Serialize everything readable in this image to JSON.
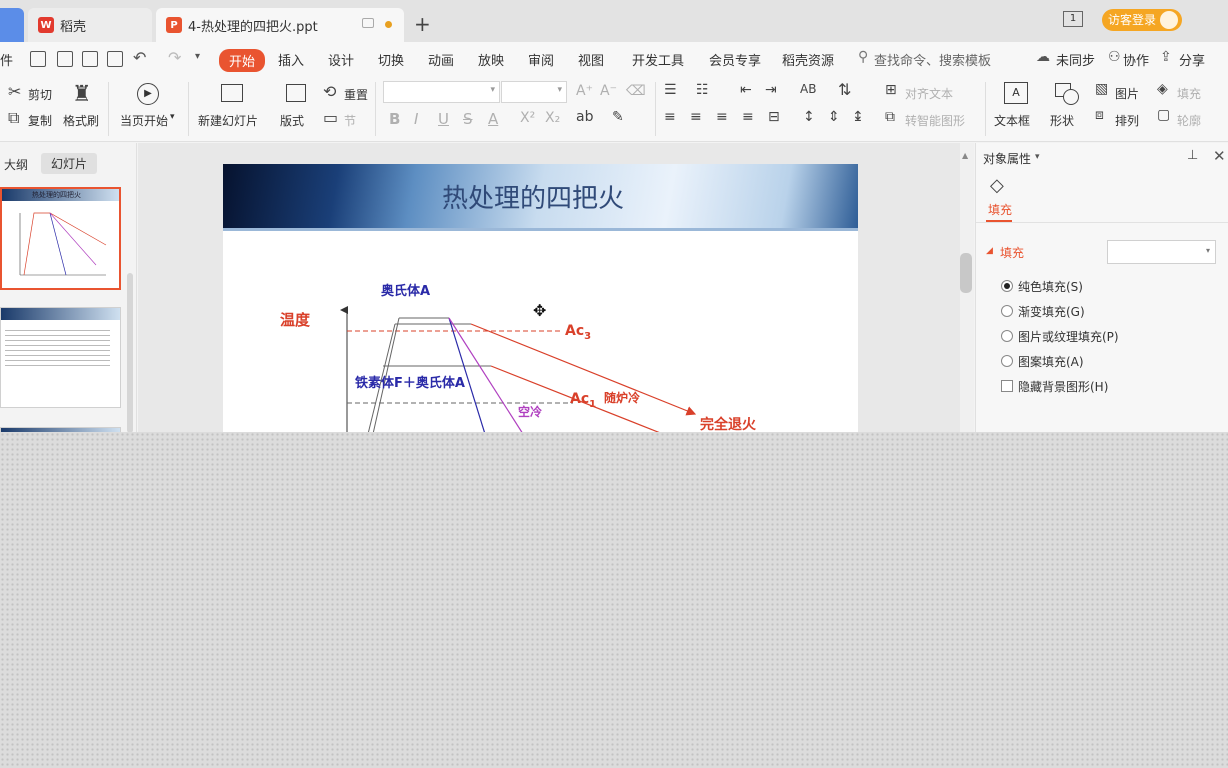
{
  "tabs": [
    {
      "label": "稻壳"
    },
    {
      "label": "4-热处理的四把火.ppt"
    }
  ],
  "titlebar": {
    "new_tab": "+",
    "window_count": "1",
    "login": "访客登录"
  },
  "menu": {
    "file_partial": "件",
    "items": [
      "开始",
      "插入",
      "设计",
      "切换",
      "动画",
      "放映",
      "审阅",
      "视图",
      "开发工具",
      "会员专享",
      "稻壳资源"
    ],
    "active_index": 0,
    "search_placeholder": "查找命令、搜索模板",
    "sync": "未同步",
    "collab": "协作",
    "share": "分享"
  },
  "ribbon": {
    "cut": "剪切",
    "copy": "复制",
    "format_painter": "格式刷",
    "play_from_current": "当页开始",
    "new_slide": "新建幻灯片",
    "layout": "版式",
    "reset": "重置",
    "section": "节",
    "font_name": "",
    "font_size": "",
    "bold": "B",
    "italic": "I",
    "underline": "U",
    "strike": "S",
    "font_color": "A",
    "superscript": "X²",
    "subscript": "X₂",
    "align_text": "对齐文本",
    "smart_art": "转智能图形",
    "textbox": "文本框",
    "shape": "形状",
    "picture": "图片",
    "arrange": "排列",
    "fill": "填充",
    "outline": "轮廓"
  },
  "left_panel": {
    "tab_outline": "大纲",
    "tab_slides": "幻灯片",
    "thumb1_title": "热处理的四把火"
  },
  "slide": {
    "title": "热处理的四把火",
    "diagram": {
      "temperature": "温度",
      "austenite": "奥氏体A",
      "ferrite_austenite": "铁素体F＋奥氏体A",
      "ac3": "Ac",
      "ac3_sub": "3",
      "ac1": "Ac",
      "ac1_sub": "1",
      "furnace_cool": "随炉冷",
      "air_cool": "空冷",
      "full_anneal": "完全退火"
    }
  },
  "right_panel": {
    "title": "对象属性",
    "fill_tab": "填充",
    "fill_section": "填充",
    "options": [
      "纯色填充(S)",
      "渐变填充(G)",
      "图片或纹理填充(P)",
      "图案填充(A)"
    ],
    "selected_option": 0,
    "hide_bg": "隐藏背景图形(H)"
  },
  "colors": {
    "accent": "#e95430",
    "diagram_red": "#d9402a",
    "diagram_blue": "#2a2aa8",
    "diagram_purple": "#b040c0"
  }
}
